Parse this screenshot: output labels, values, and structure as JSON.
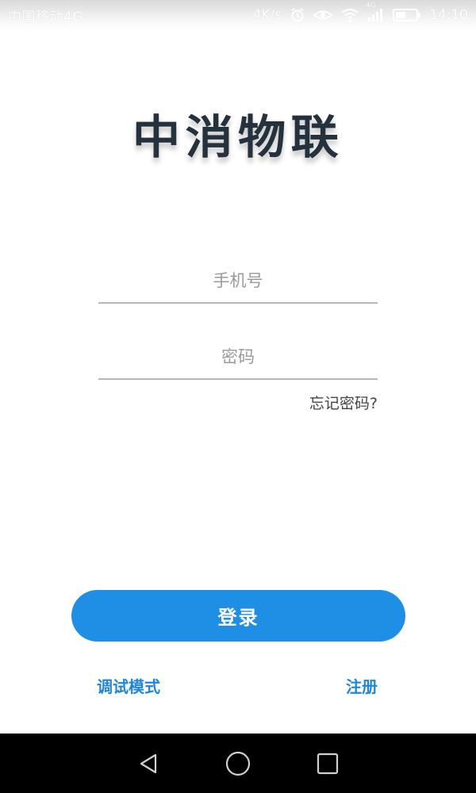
{
  "status_bar": {
    "carrier": "中国移动4G",
    "speed": "4K/s",
    "network_badge": "4G",
    "time": "14:10",
    "icons": [
      "alarm-icon",
      "eye-icon",
      "wifi-icon",
      "signal-icon",
      "battery-icon"
    ]
  },
  "logo": {
    "text": "中消物联"
  },
  "form": {
    "phone": {
      "placeholder": "手机号",
      "value": ""
    },
    "password": {
      "placeholder": "密码",
      "value": ""
    },
    "forgot_label": "忘记密码?"
  },
  "actions": {
    "login_label": "登录",
    "debug_mode_label": "调试模式",
    "register_label": "注册"
  },
  "nav_bar": {
    "buttons": [
      "back-icon",
      "home-icon",
      "recents-icon"
    ]
  },
  "colors": {
    "accent": "#1f8fe6",
    "link": "#1f86d9",
    "logo": "#25313d",
    "underline": "#b8b8b8"
  }
}
